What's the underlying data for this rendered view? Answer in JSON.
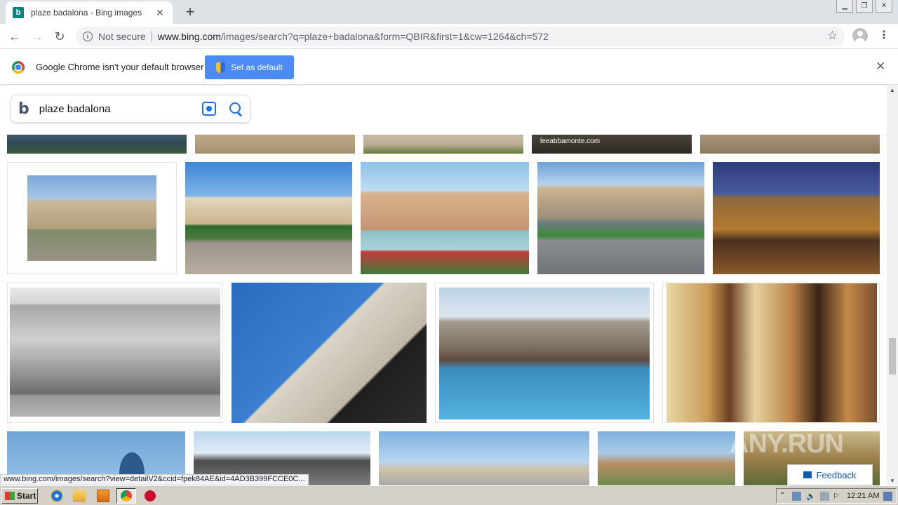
{
  "browser": {
    "tab_title": "plaze badalona - Bing images",
    "tab_favicon": "b",
    "security_label": "Not secure",
    "url_host": "www.bing.com",
    "url_path": "/images/search?q=plaze+badalona&form=QBIR&first=1&cw=1264&ch=572",
    "window_controls": [
      "minimize-icon",
      "restore-icon",
      "close-icon"
    ]
  },
  "infobar": {
    "message": "Google Chrome isn't your default browser",
    "button_label": "Set as default"
  },
  "search": {
    "logo": "b",
    "query": "plaze badalona"
  },
  "results": {
    "caption_text": "leeabbamonte.com"
  },
  "feedback_label": "Feedback",
  "watermark_text": "ANY.RUN",
  "status_url": "www.bing.com/images/search?view=detailV2&ccid=fpek84AE&id=4AD3B399FCCE0C...",
  "taskbar": {
    "start_label": "Start",
    "clock": "12:21 AM"
  },
  "colors": {
    "accent": "#1a73e8",
    "infobar_button": "#4c8bf5",
    "taskbar": "#d4d0c8"
  }
}
